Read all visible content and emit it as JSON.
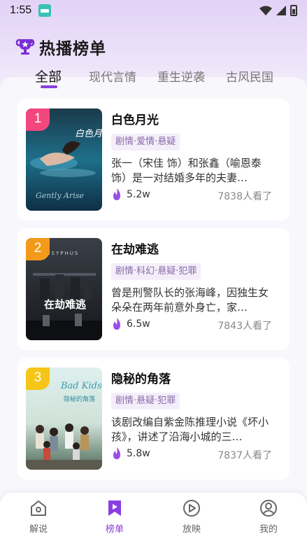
{
  "status_bar": {
    "time": "1:55"
  },
  "header": {
    "title": "热播榜单",
    "trophy_icon": "trophy-icon"
  },
  "tabs": [
    {
      "label": "全部",
      "active": true
    },
    {
      "label": "现代言情",
      "active": false
    },
    {
      "label": "重生逆袭",
      "active": false
    },
    {
      "label": "古风民国",
      "active": false
    }
  ],
  "cards": [
    {
      "rank": "1",
      "title": "白色月光",
      "tags": "剧情·爱情·悬疑",
      "desc": "张一（宋佳 饰）和张鑫（喻恩泰 饰）是一对结婚多年的夫妻…",
      "heat": "5.2w",
      "views": "7838人看了",
      "poster_text": "白色月光",
      "poster_script": "Gently Arise",
      "badge_color": "#f2467f"
    },
    {
      "rank": "2",
      "title": "在劫难逃",
      "tags": "剧情·科幻·悬疑·犯罪",
      "desc": "曾是刑警队长的张海峰，因独生女朵朵在两年前意外身亡，家…",
      "heat": "6.5w",
      "views": "7843人看了",
      "poster_text": "在劫难逃",
      "poster_script": "SISYPHUS",
      "badge_color": "#f39a1b"
    },
    {
      "rank": "3",
      "title": "隐秘的角落",
      "tags": "剧情·悬疑·犯罪",
      "desc": "该剧改编自紫金陈推理小说《坏小孩》，讲述了沿海小城的三…",
      "heat": "5.8w",
      "views": "7837人看了",
      "poster_text": "隐秘的角落",
      "poster_script": "Bad Kids",
      "badge_color": "#f5c518"
    }
  ],
  "nav": [
    {
      "label": "解说",
      "icon": "home-icon",
      "active": false
    },
    {
      "label": "榜单",
      "icon": "bookmark-play-icon",
      "active": true
    },
    {
      "label": "放映",
      "icon": "play-circle-icon",
      "active": false
    },
    {
      "label": "我的",
      "icon": "user-icon",
      "active": false
    }
  ],
  "colors": {
    "accent": "#8a3ee0",
    "flame": "#9b4fe8"
  }
}
